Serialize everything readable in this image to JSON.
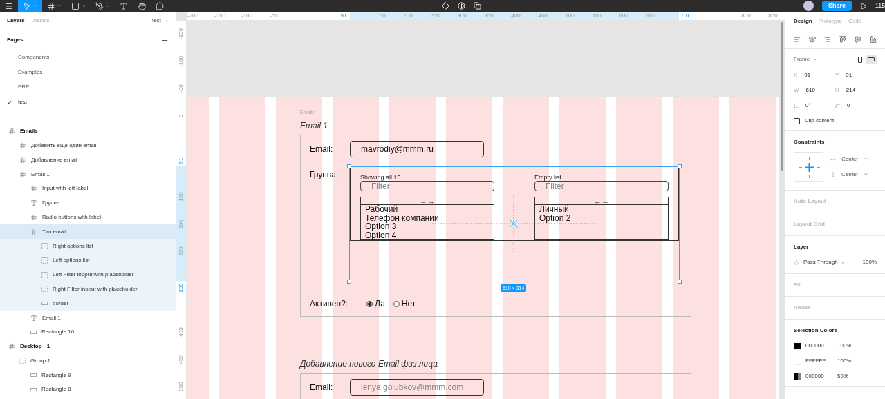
{
  "toolbar": {
    "tools": [
      {
        "kind": "menu",
        "selected": false
      },
      {
        "kind": "move",
        "selected": true
      },
      {
        "kind": "frame",
        "selected": false
      },
      {
        "kind": "shape",
        "selected": false
      },
      {
        "kind": "pen",
        "selected": false
      },
      {
        "kind": "text",
        "selected": false
      },
      {
        "kind": "hand",
        "selected": false
      },
      {
        "kind": "comment",
        "selected": false
      }
    ],
    "center_tools": [
      {
        "kind": "component"
      },
      {
        "kind": "contrast"
      },
      {
        "kind": "boolean"
      }
    ],
    "share": "Share",
    "zoom": "115"
  },
  "left_panel": {
    "tabs": [
      {
        "label": "Layers",
        "selected": true
      },
      {
        "label": "Assets",
        "selected": false
      }
    ],
    "page_name": "test",
    "pages_title": "Pages",
    "pages": [
      {
        "label": "Components",
        "selected": false
      },
      {
        "label": "Examples",
        "selected": false
      },
      {
        "label": "ERP",
        "selected": false
      },
      {
        "label": "test",
        "selected": true
      }
    ],
    "layers": [
      {
        "name": "Emails",
        "kind": "frame",
        "selected": false,
        "children": [
          {
            "name": "Добавить еще один email",
            "kind": "frame",
            "selected": false
          },
          {
            "name": "Добавление email",
            "kind": "frame",
            "selected": false
          },
          {
            "name": "Email 1",
            "kind": "frame",
            "selected": false,
            "children": [
              {
                "name": "Input with left label",
                "kind": "frame",
                "selected": false
              },
              {
                "name": "Группа:",
                "kind": "text",
                "selected": false
              },
              {
                "name": "Radio buttons with label",
                "kind": "frame",
                "selected": false
              },
              {
                "name": "Тип email",
                "kind": "frame",
                "selected": true,
                "children": [
                  {
                    "name": "Right options list",
                    "kind": "group",
                    "selected": false
                  },
                  {
                    "name": "Left options list",
                    "kind": "group",
                    "selected": false
                  },
                  {
                    "name": "Left Filter inoput with placeholder",
                    "kind": "group",
                    "selected": false
                  },
                  {
                    "name": "Right Filter inoput with placeholder",
                    "kind": "group",
                    "selected": false
                  },
                  {
                    "name": "border",
                    "kind": "rect",
                    "selected": false
                  }
                ]
              },
              {
                "name": "Email 1",
                "kind": "text",
                "selected": false
              },
              {
                "name": "Rectangle 10",
                "kind": "rect",
                "selected": false
              }
            ]
          }
        ]
      },
      {
        "name": "Desktop - 1",
        "kind": "frame",
        "selected": false,
        "children": [
          {
            "name": "Group 1",
            "kind": "group",
            "selected": false,
            "children": [
              {
                "name": "Rectangle 9",
                "kind": "rect",
                "selected": false
              },
              {
                "name": "Rectangle 8",
                "kind": "rect",
                "selected": false
              }
            ]
          }
        ]
      }
    ]
  },
  "rulers": {
    "top": [
      {
        "text": "-200",
        "selected": false
      },
      {
        "text": "-150",
        "selected": false
      },
      {
        "text": "-100",
        "selected": false
      },
      {
        "text": "-50",
        "selected": false
      },
      {
        "text": "0",
        "selected": false
      },
      {
        "text": "91",
        "selected": true
      },
      {
        "text": "150",
        "selected": false
      },
      {
        "text": "200",
        "selected": false
      },
      {
        "text": "250",
        "selected": false
      },
      {
        "text": "300",
        "selected": false
      },
      {
        "text": "350",
        "selected": false
      },
      {
        "text": "400",
        "selected": false
      },
      {
        "text": "450",
        "selected": false
      },
      {
        "text": "500",
        "selected": false
      },
      {
        "text": "550",
        "selected": false
      },
      {
        "text": "600",
        "selected": false
      },
      {
        "text": "650",
        "selected": false
      },
      {
        "text": "701",
        "selected": true
      },
      {
        "text": "800",
        "selected": false
      },
      {
        "text": "850",
        "selected": false
      }
    ],
    "left": [
      {
        "text": "-150",
        "selected": false
      },
      {
        "text": "-100",
        "selected": false
      },
      {
        "text": "-50",
        "selected": false
      },
      {
        "text": "0",
        "selected": false
      },
      {
        "text": "91",
        "selected": true
      },
      {
        "text": "150",
        "selected": false
      },
      {
        "text": "200",
        "selected": false
      },
      {
        "text": "250",
        "selected": false
      },
      {
        "text": "305",
        "selected": true
      },
      {
        "text": "400",
        "selected": false
      },
      {
        "text": "450",
        "selected": false
      },
      {
        "text": "500",
        "selected": false
      }
    ]
  },
  "canvas": {
    "frame_label": "Emails",
    "section_1": {
      "title": "Email 1",
      "email": {
        "label": "Email:",
        "value": "mavrodiy@mmm.ru"
      },
      "group_label": "Группа:",
      "dual_list": {
        "left": {
          "caption": "Showing all 10",
          "filter_placeholder": "Filter",
          "move_button": "→→",
          "options": [
            "Рабочий",
            "Телефон компании",
            "Option 3",
            "Option 4"
          ]
        },
        "right": {
          "caption": "Empty list",
          "filter_placeholder": "Filter",
          "move_button": "←←",
          "options": [
            "Личный",
            "Option 2"
          ]
        }
      },
      "size_badge": "610 × 214",
      "active": {
        "label": "Активен?:",
        "options": [
          {
            "label": "Да",
            "selected": true
          },
          {
            "label": "Нет",
            "selected": false
          }
        ]
      }
    },
    "section_2": {
      "title": "Добавление нового Email физ лица",
      "email": {
        "label": "Email:",
        "placeholder": "lenya.golubkov@mmm.com"
      }
    }
  },
  "design_panel": {
    "tabs": [
      {
        "label": "Design",
        "selected": true
      },
      {
        "label": "Prototype",
        "selected": false
      },
      {
        "label": "Code",
        "selected": false
      }
    ],
    "frame_label": "Frame",
    "orientation": [
      {
        "kind": "portrait",
        "selected": false
      },
      {
        "kind": "landscape",
        "selected": true
      }
    ],
    "fields": [
      {
        "label": "X",
        "value": "91"
      },
      {
        "label": "Y",
        "value": "91"
      },
      {
        "label": "W",
        "value": "610"
      },
      {
        "label": "H",
        "value": "214"
      }
    ],
    "rotation": "0°",
    "radius": "0",
    "clip_content": {
      "label": "Clip content",
      "checked": false
    },
    "constraints": {
      "title": "Constraints",
      "horizontal": "Center",
      "vertical": "Center"
    },
    "auto_layout": "Auto Layout",
    "layout_grid": "Layout Grid",
    "layer": {
      "title": "Layer",
      "blend": "Pass Through",
      "opacity": "100%"
    },
    "fill": "Fill",
    "stroke": "Stroke",
    "selection_colors": {
      "title": "Selection Colors",
      "items": [
        {
          "hex": "000000",
          "opacity": "100%",
          "color": "#000000",
          "kind": "solid"
        },
        {
          "hex": "FFFFFF",
          "opacity": "100%",
          "color": "#ffffff",
          "kind": "solid"
        },
        {
          "hex": "000000",
          "opacity": "50%",
          "color": "#000000",
          "kind": "translucent"
        }
      ]
    }
  }
}
